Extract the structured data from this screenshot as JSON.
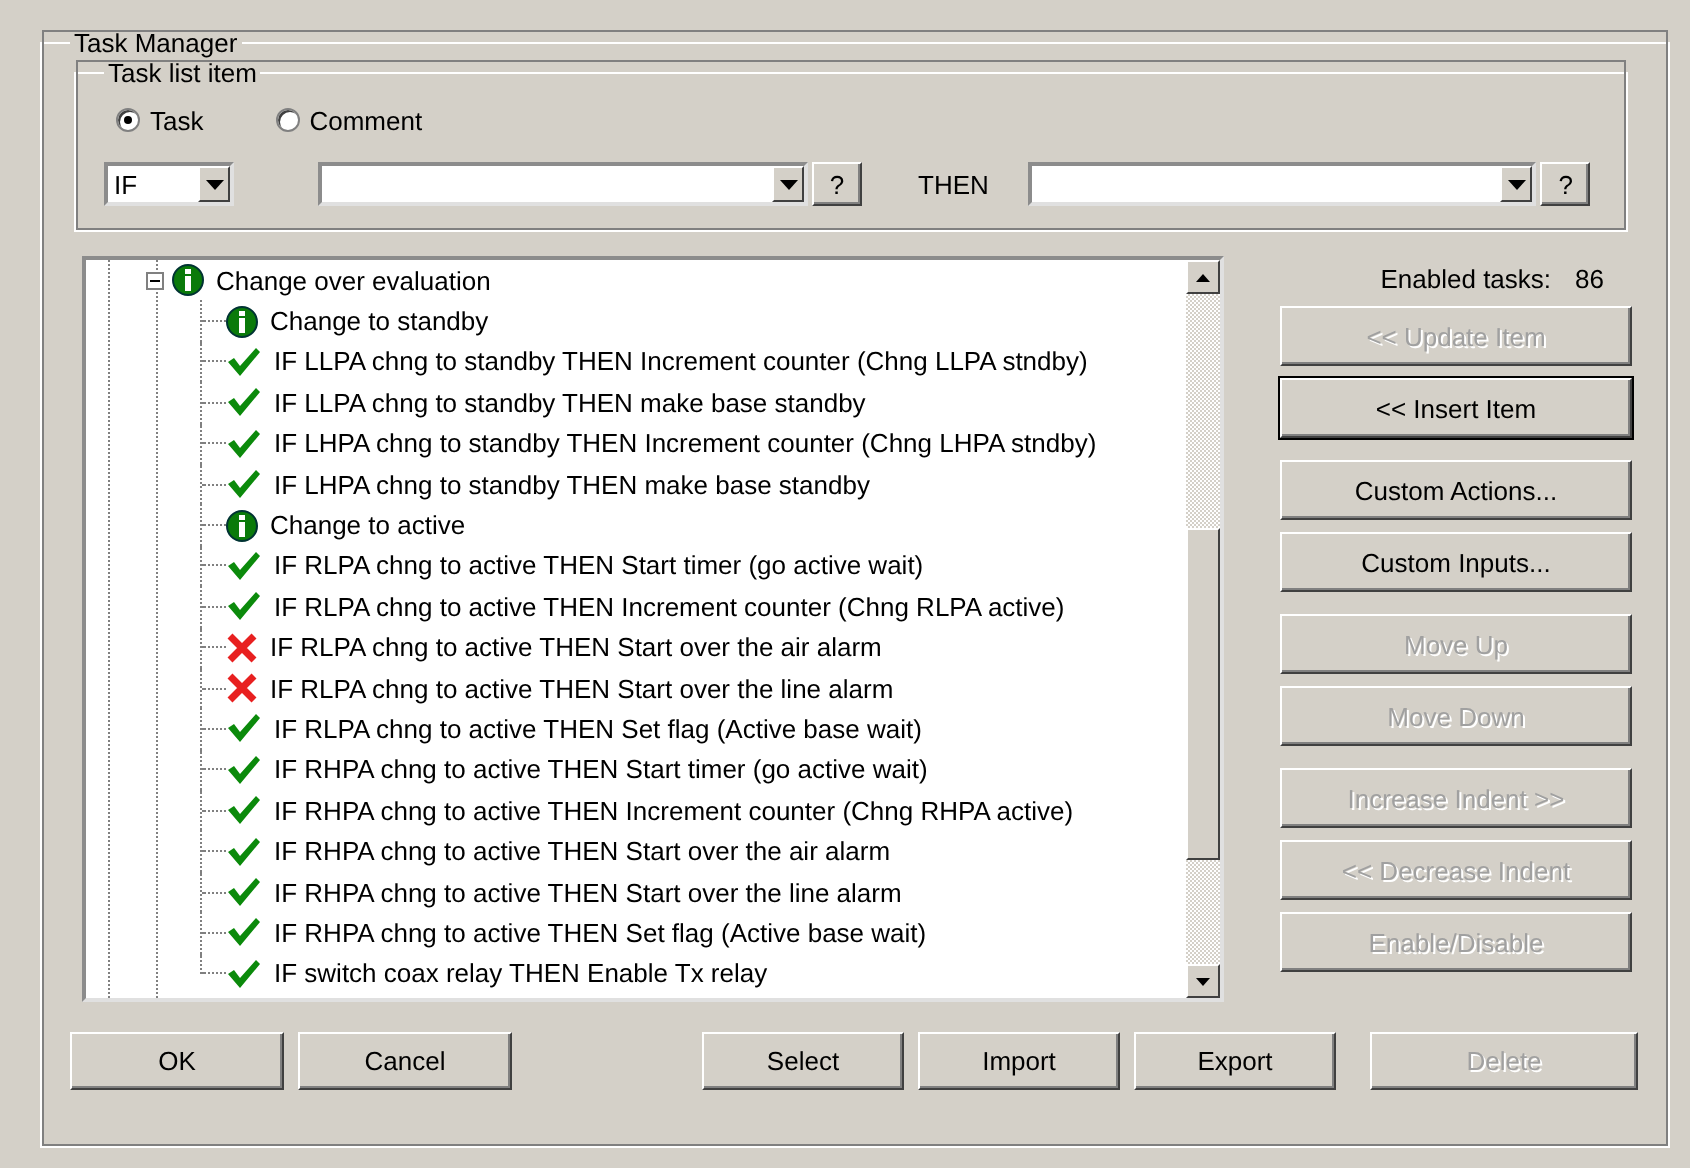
{
  "group": {
    "title": "Task Manager"
  },
  "task_list_item": {
    "title": "Task list item",
    "radios": [
      {
        "label": "Task",
        "selected": true
      },
      {
        "label": "Comment",
        "selected": false
      }
    ],
    "condition_type": {
      "value": "IF"
    },
    "if_combo": {
      "help": "?"
    },
    "then_label": "THEN",
    "then_combo": {
      "help": "?"
    }
  },
  "tree": {
    "items": [
      {
        "kind": "info",
        "label": "Change over evaluation",
        "expanded": true,
        "children": [
          {
            "kind": "info",
            "label": "Change to standby"
          },
          {
            "kind": "enabled",
            "label": "IF LLPA chng to standby THEN Increment counter (Chng LLPA stndby)"
          },
          {
            "kind": "enabled",
            "label": "IF LLPA chng to standby THEN make base standby"
          },
          {
            "kind": "enabled",
            "label": "IF LHPA chng to standby THEN Increment counter (Chng LHPA stndby)"
          },
          {
            "kind": "enabled",
            "label": "IF LHPA chng to standby THEN make base standby"
          },
          {
            "kind": "info",
            "label": "Change to active"
          },
          {
            "kind": "enabled",
            "label": "IF RLPA chng to active THEN Start timer (go active wait)"
          },
          {
            "kind": "enabled",
            "label": "IF RLPA chng to active THEN Increment counter (Chng RLPA active)"
          },
          {
            "kind": "disabled",
            "label": "IF RLPA chng to active THEN Start over the air alarm"
          },
          {
            "kind": "disabled",
            "label": "IF RLPA chng to active THEN Start over the line alarm"
          },
          {
            "kind": "enabled",
            "label": "IF RLPA chng to active THEN Set flag (Active base wait)"
          },
          {
            "kind": "enabled",
            "label": "IF RHPA chng to active THEN Start timer (go active wait)"
          },
          {
            "kind": "enabled",
            "label": "IF RHPA chng to active THEN Increment counter (Chng RHPA active)"
          },
          {
            "kind": "enabled",
            "label": "IF RHPA chng to active THEN Start over the air alarm"
          },
          {
            "kind": "enabled",
            "label": "IF RHPA chng to active THEN Start over the line alarm"
          },
          {
            "kind": "enabled",
            "label": "IF RHPA chng to active THEN Set flag (Active base wait)"
          },
          {
            "kind": "enabled",
            "label": "IF switch coax relay THEN Enable Tx relay"
          }
        ]
      }
    ]
  },
  "enabled_tasks": {
    "label": "Enabled tasks:",
    "count": "86"
  },
  "side_button_groups": [
    [
      {
        "label": "<<  Update Item",
        "disabled": true,
        "default": false
      },
      {
        "label": "<< Insert Item",
        "disabled": false,
        "default": true
      }
    ],
    [
      {
        "label": "Custom Actions...",
        "disabled": false,
        "default": false
      },
      {
        "label": "Custom Inputs...",
        "disabled": false,
        "default": false
      }
    ],
    [
      {
        "label": "Move Up",
        "disabled": true,
        "default": false
      },
      {
        "label": "Move Down",
        "disabled": true,
        "default": false
      }
    ],
    [
      {
        "label": "Increase Indent >>",
        "disabled": true,
        "default": false
      },
      {
        "label": "<< Decrease Indent",
        "disabled": true,
        "default": false
      },
      {
        "label": "Enable/Disable",
        "disabled": true,
        "default": false
      }
    ]
  ],
  "bottom_button_groups": [
    [
      {
        "label": "OK",
        "disabled": false
      },
      {
        "label": "Cancel",
        "disabled": false
      }
    ],
    [
      {
        "label": "Select",
        "disabled": false
      },
      {
        "label": "Import",
        "disabled": false
      },
      {
        "label": "Export",
        "disabled": false
      }
    ],
    [
      {
        "label": "Delete",
        "disabled": true
      }
    ]
  ]
}
